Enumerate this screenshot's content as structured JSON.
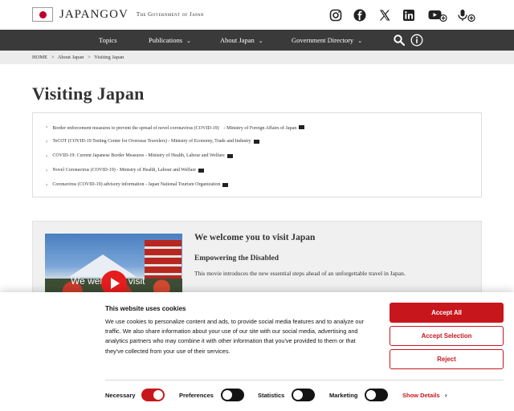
{
  "header": {
    "logo_text": "JAPANGOV",
    "logo_subtext": "The Government of Japan",
    "social_icons": [
      "instagram-icon",
      "facebook-icon",
      "x-icon",
      "linkedin-icon",
      "youtube-add-icon",
      "podcast-add-icon"
    ]
  },
  "nav": {
    "items": [
      {
        "label": "Topics",
        "has_dropdown": false
      },
      {
        "label": "Publications",
        "has_dropdown": true
      },
      {
        "label": "About Japan",
        "has_dropdown": true
      },
      {
        "label": "Government Directory",
        "has_dropdown": true
      }
    ],
    "search_icon": "search-icon",
    "info_icon": "info-icon"
  },
  "breadcrumb": [
    "HOME",
    ">",
    "About Japan",
    ">",
    "Visiting Japan"
  ],
  "page_title": "Visiting Japan",
  "links": [
    "Border enforcement measures to prevent the spread of novel coronavirus (COVID-19)　- Ministry of Foreign Affairs of Japan",
    "TeCOT (COVID-19 Testing Center for Overseas Travelers) - Ministry of Economy, Trade and Industry",
    "COVID-19: Current Japanese Border Measures - Ministry of Health, Labour and Welfare",
    "Novel Coronavirus (COVID-19) - Ministry of Health, Labour and Welfare",
    "Coronavirus (COVID-19) advisory information - Japan National Tourism Organization"
  ],
  "feature": {
    "title": "We welcome you to visit Japan",
    "subtitle": "Empowering the Disabled",
    "description": "This movie introduces the new essential steps ahead of an unforgettable travel in Japan.",
    "video_overlay_text": "We welc    u to visit"
  },
  "cookie": {
    "title": "This website uses cookies",
    "text": "We use cookies to personalize content and ads, to provide social media features and to analyze our traffic. We also share information about your use of our site with our social media, advertising and analytics partners who may combine it with other information that you've provided to them or that they've collected from your use of their services.",
    "accept_all": "Accept All",
    "accept_selection": "Accept Selection",
    "reject": "Reject",
    "toggles": [
      {
        "label": "Necessary",
        "on": true
      },
      {
        "label": "Preferences",
        "on": false
      },
      {
        "label": "Statistics",
        "on": false
      },
      {
        "label": "Marketing",
        "on": false
      }
    ],
    "show_details": "Show Details",
    "accent_color": "#c8161d"
  }
}
